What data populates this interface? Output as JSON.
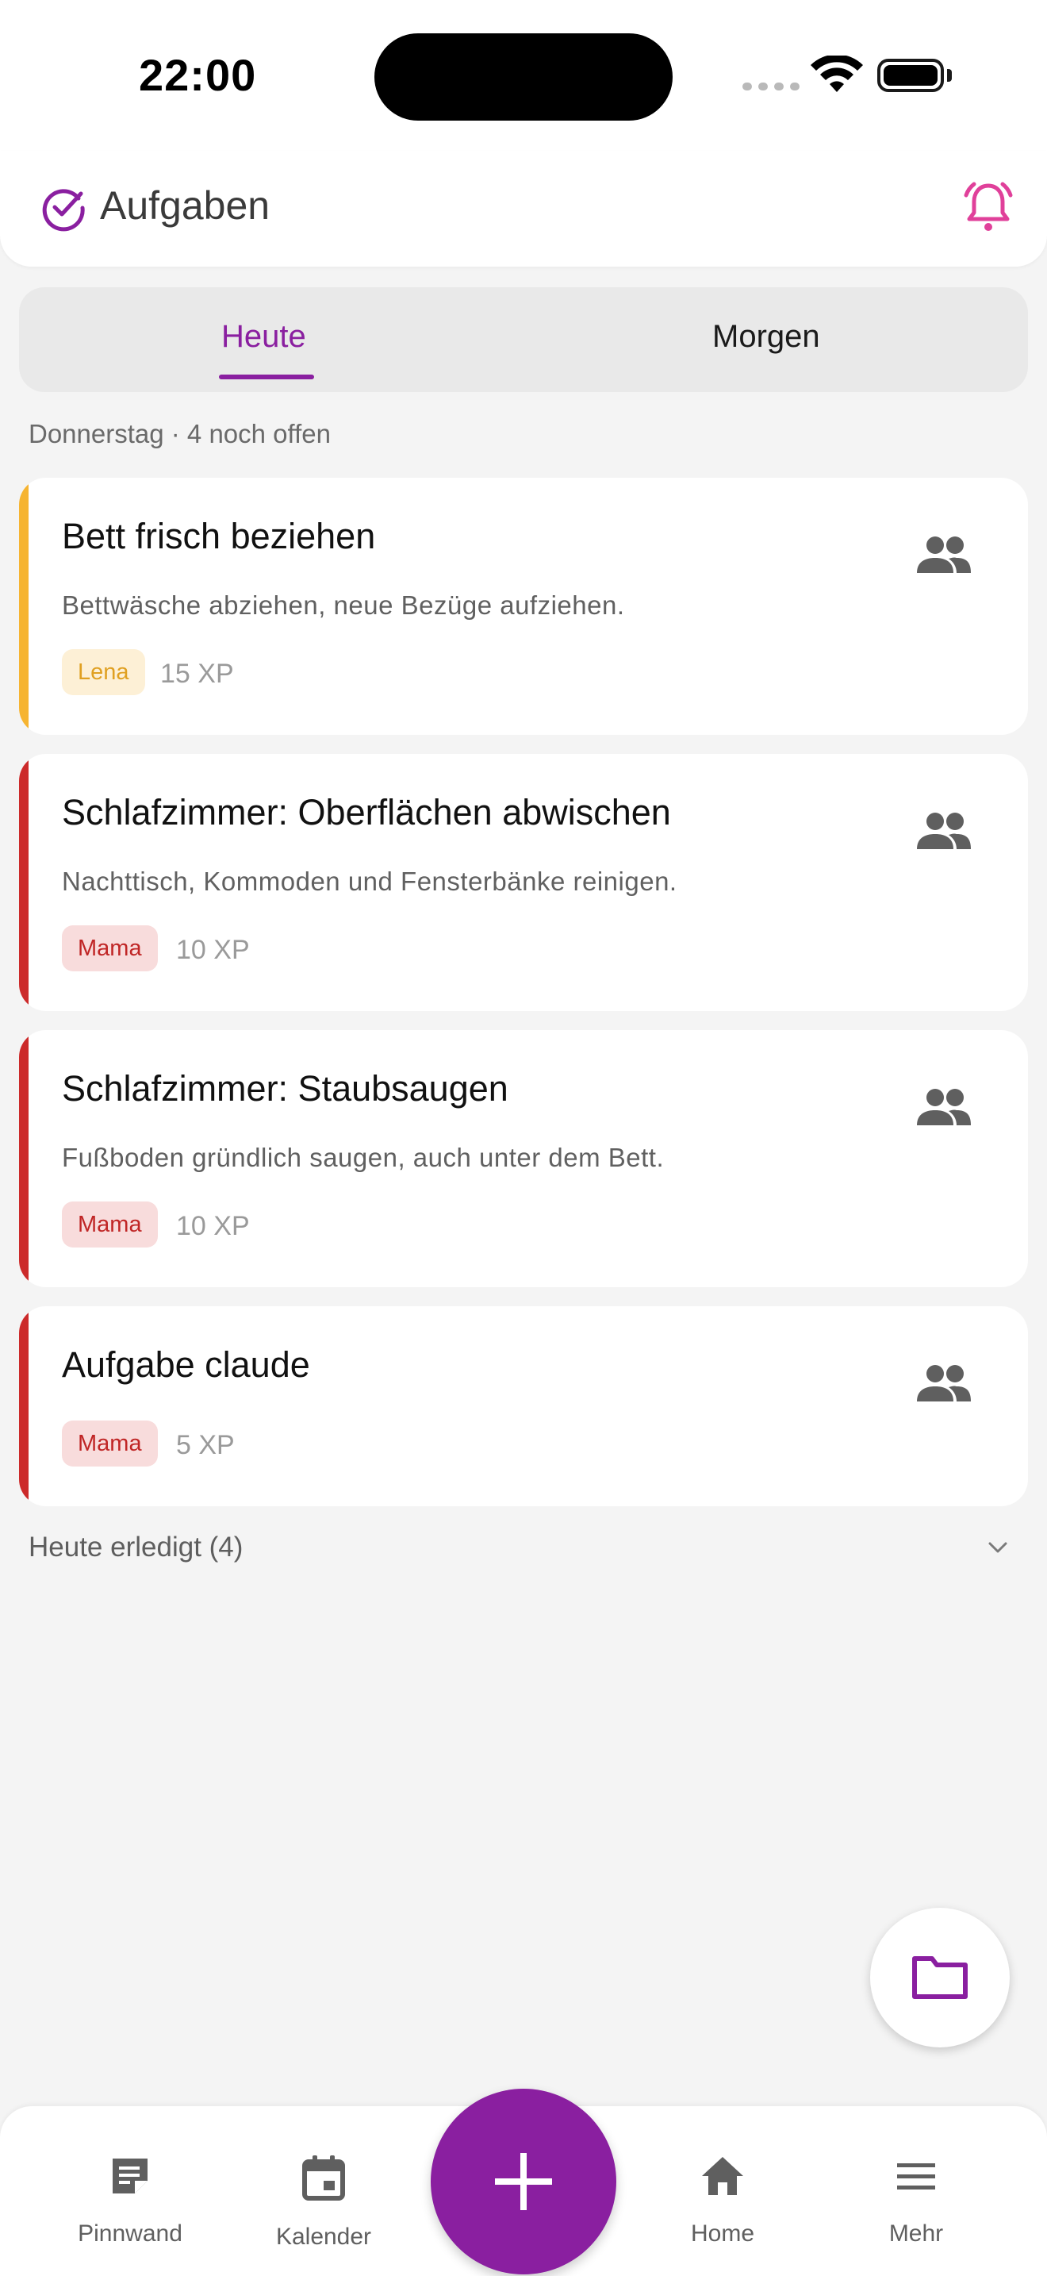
{
  "status_bar": {
    "time": "22:00"
  },
  "app_bar": {
    "title": "Aufgaben"
  },
  "tabs": [
    {
      "label": "Heute",
      "selected": true
    },
    {
      "label": "Morgen",
      "selected": false
    }
  ],
  "summary": "Donnerstag · 4 noch offen",
  "tasks": [
    {
      "title": "Bett frisch beziehen",
      "description": "Bettwäsche abziehen, neue Bezüge aufziehen.",
      "assignee": "Lena",
      "xp": "15 XP",
      "accent_color": "#f6b431",
      "badge_bg": "#fdf0d6",
      "badge_fg": "#e0a021"
    },
    {
      "title": "Schlafzimmer: Oberflächen abwischen",
      "description": "Nachttisch, Kommoden und Fensterbänke reinigen.",
      "assignee": "Mama",
      "xp": "10 XP",
      "accent_color": "#cc2a2a",
      "badge_bg": "#f8dcdc",
      "badge_fg": "#c02626"
    },
    {
      "title": "Schlafzimmer: Staubsaugen",
      "description": "Fußboden gründlich saugen, auch unter dem Bett.",
      "assignee": "Mama",
      "xp": "10 XP",
      "accent_color": "#cc2a2a",
      "badge_bg": "#f8dcdc",
      "badge_fg": "#c02626"
    },
    {
      "title": "Aufgabe claude",
      "description": "",
      "assignee": "Mama",
      "xp": "5 XP",
      "accent_color": "#cc2a2a",
      "badge_bg": "#f8dcdc",
      "badge_fg": "#c02626"
    }
  ],
  "done_section": {
    "label": "Heute erledigt (4)"
  },
  "nav": {
    "pinnwand": "Pinnwand",
    "kalender": "Kalender",
    "home": "Home",
    "mehr": "Mehr"
  },
  "colors": {
    "primary": "#8a1fa0",
    "bell": "#e0409a"
  }
}
